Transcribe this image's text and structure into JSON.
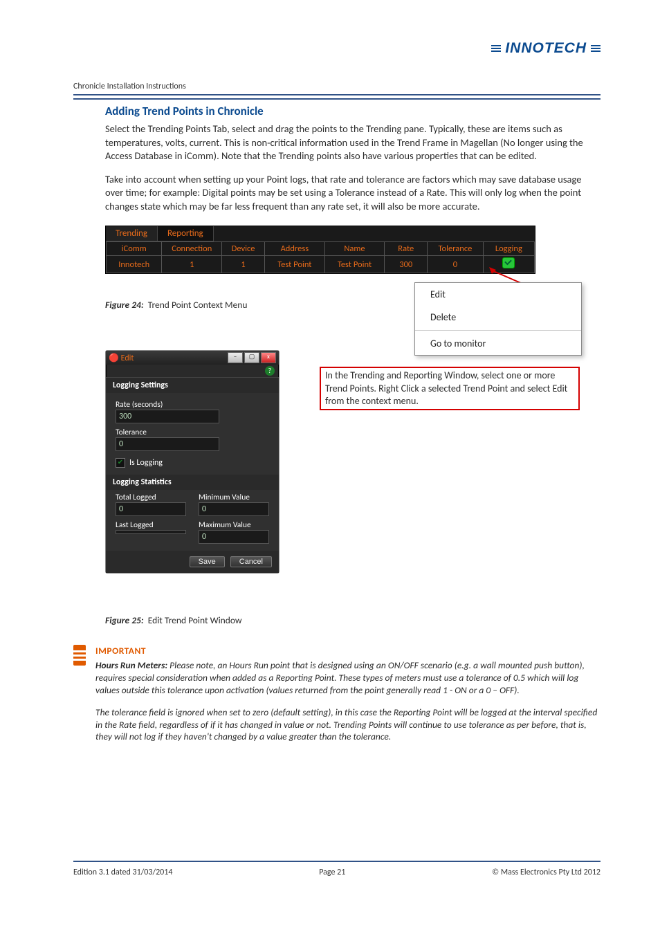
{
  "header": {
    "running": "Chronicle Installation Instructions",
    "logo": "INNOTECH"
  },
  "section": {
    "title": "Adding Trend Points in Chronicle",
    "para1": "Select the Trending Points Tab, select and drag the points to the Trending pane. Typically, these are items such as temperatures, volts, current. This is non-critical information used in the Trend Frame in Magellan (No longer using the Access Database in iComm). Note that the Trending points also have various properties that can be edited.",
    "para2": "Take into account when setting up your Point logs, that rate and tolerance are factors which may save database usage over time; for example: Digital points may be set using a Tolerance instead of a Rate. This will only log when the point changes state which may be far less frequent than any rate set, it will also be more accurate."
  },
  "fig24": {
    "label": "Figure 24:",
    "caption": "Trend Point Context Menu"
  },
  "trend": {
    "tabs": {
      "trending": "Trending",
      "reporting": "Reporting"
    },
    "cols": {
      "icomm": "iComm",
      "connection": "Connection",
      "device": "Device",
      "address": "Address",
      "name": "Name",
      "rate": "Rate",
      "tolerance": "Tolerance",
      "logging": "Logging"
    },
    "row": {
      "icomm": "Innotech",
      "connection": "1",
      "device": "1",
      "address": "Test Point",
      "name": "Test Point",
      "rate": "300",
      "tolerance": "0"
    }
  },
  "ctx": {
    "edit": "Edit",
    "delete": "Delete",
    "goto": "Go to monitor"
  },
  "redbox": "In the Trending and Reporting Window, select one or more Trend Points. Right Click a selected Trend Point and select Edit from the context menu.",
  "editwin": {
    "title": "Edit",
    "logging_settings": "Logging Settings",
    "rate_lbl": "Rate (seconds)",
    "rate_val": "300",
    "tol_lbl": "Tolerance",
    "tol_val": "0",
    "islogging": "Is Logging",
    "logging_stats": "Logging Statistics",
    "total_logged": "Total Logged",
    "total_logged_v": "0",
    "last_logged": "Last Logged",
    "last_logged_v": "",
    "min_v_lbl": "Minimum Value",
    "min_v": "0",
    "max_v_lbl": "Maximum Value",
    "max_v": "0",
    "save": "Save",
    "cancel": "Cancel"
  },
  "fig25": {
    "label": "Figure 25:",
    "caption": "Edit Trend Point Window"
  },
  "important": {
    "title": "IMPORTANT",
    "p1a": "Hours Run Meters:",
    "p1b": " Please note, an Hours Run point that is designed using an ON/OFF scenario (e.g. a wall mounted push button), requires special consideration when added as a Reporting Point. These types of meters must use a tolerance of 0.5 which will log values outside this tolerance upon activation (values returned from the point generally read 1 - ON or a 0 – OFF).",
    "p2": "The tolerance field is ignored when set to zero (default setting), in this case the Reporting Point will be logged at the interval specified in the Rate field, regardless of if it has changed in value or not. Trending Points will continue to use tolerance as per before, that is, they will not log if they haven't changed by a value greater than the tolerance."
  },
  "footer": {
    "left": "Edition 3.1 dated 31/03/2014",
    "center": "Page 21",
    "right": "©  Mass Electronics Pty Ltd  2012"
  }
}
